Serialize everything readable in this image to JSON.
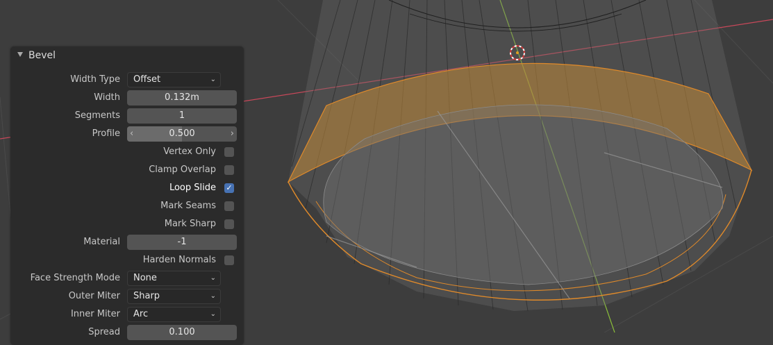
{
  "panel": {
    "title": "Bevel",
    "width_type": {
      "label": "Width Type",
      "value": "Offset"
    },
    "width": {
      "label": "Width",
      "value": "0.132m"
    },
    "segments": {
      "label": "Segments",
      "value": "1"
    },
    "profile": {
      "label": "Profile",
      "value": "0.500",
      "fraction": 0.5
    },
    "vertex_only": {
      "label": "Vertex Only",
      "checked": false
    },
    "clamp_overlap": {
      "label": "Clamp Overlap",
      "checked": false
    },
    "loop_slide": {
      "label": "Loop Slide",
      "checked": true
    },
    "mark_seams": {
      "label": "Mark Seams",
      "checked": false
    },
    "mark_sharp": {
      "label": "Mark Sharp",
      "checked": false
    },
    "material": {
      "label": "Material",
      "value": "-1"
    },
    "harden_normals": {
      "label": "Harden Normals",
      "checked": false
    },
    "face_strength_mode": {
      "label": "Face Strength Mode",
      "value": "None"
    },
    "outer_miter": {
      "label": "Outer Miter",
      "value": "Sharp"
    },
    "inner_miter": {
      "label": "Inner Miter",
      "value": "Arc"
    },
    "spread": {
      "label": "Spread",
      "value": "0.100"
    }
  },
  "colors": {
    "viewport_bg": "#3d3d3d",
    "selection_orange": "#e08a2a",
    "x_axis": "#c9485a",
    "y_axis": "#8bbf3a",
    "checkbox_on": "#4772b3"
  },
  "icons": [
    "collapse-triangle-icon",
    "chevron-down-icon",
    "checkmark-icon",
    "arrow-left-icon",
    "arrow-right-icon",
    "3d-cursor-icon"
  ]
}
